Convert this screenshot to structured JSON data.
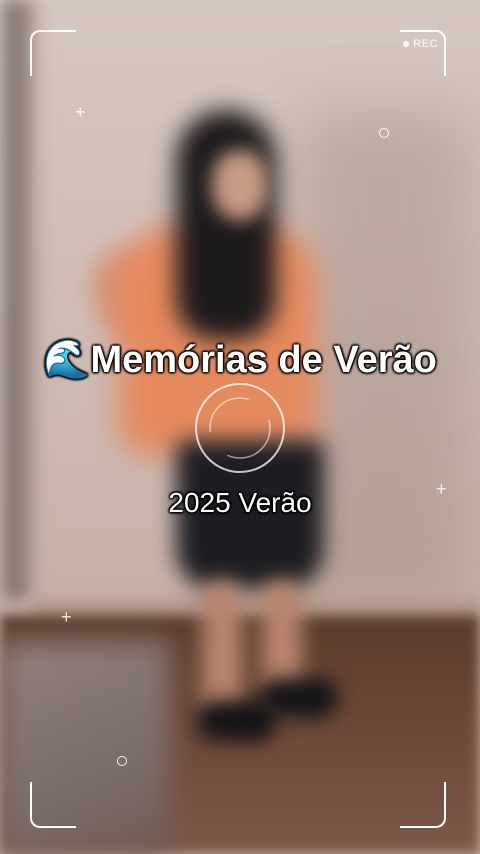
{
  "overlay": {
    "rec_label": "REC",
    "title": "🌊Memórias de Verão",
    "subtitle": "2025 Verão"
  },
  "colors": {
    "frame": "#ffffff",
    "text": "#ffffff",
    "text_outline": "#000000"
  },
  "icons": [
    "rec-dot-icon",
    "plus-sparkle-icon",
    "ring-sparkle-icon",
    "focus-target-icon",
    "wave-emoji"
  ]
}
